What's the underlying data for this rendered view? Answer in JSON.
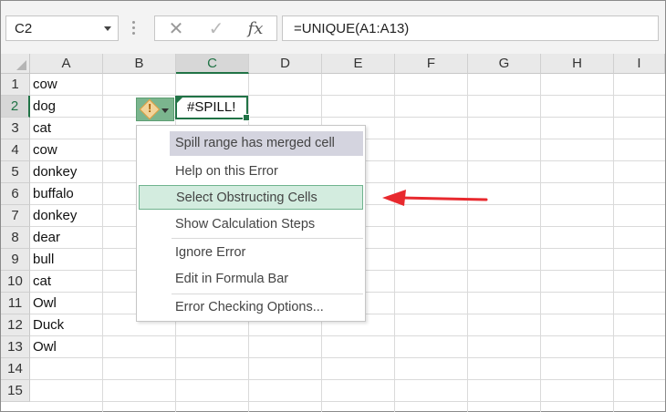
{
  "name_box": {
    "value": "C2"
  },
  "formula_bar": {
    "cancel_glyph": "✕",
    "enter_glyph": "✓",
    "fx_label": "fx",
    "formula": "=UNIQUE(A1:A13)"
  },
  "columns": [
    "A",
    "B",
    "C",
    "D",
    "E",
    "F",
    "G",
    "H",
    "I"
  ],
  "rows": [
    "1",
    "2",
    "3",
    "4",
    "5",
    "6",
    "7",
    "8",
    "9",
    "10",
    "11",
    "12",
    "13",
    "14",
    "15"
  ],
  "column_a": [
    "cow",
    "dog",
    "cat",
    "cow",
    "donkey",
    "buffalo",
    "donkey",
    "dear",
    "bull",
    "cat",
    "Owl",
    "Duck",
    "Owl"
  ],
  "active_cell": {
    "ref": "C2",
    "value": "#SPILL!"
  },
  "error_menu": {
    "title": "Spill range has merged cell",
    "items": [
      "Help on this Error",
      "Select Obstructing Cells",
      "Show Calculation Steps",
      "Ignore Error",
      "Edit in Formula Bar",
      "Error Checking Options..."
    ],
    "highlighted_index": 1
  },
  "colors": {
    "excel_green": "#217346",
    "arrow_red": "#e8292e",
    "menu_header_bg": "#d4d4df",
    "menu_hover_bg": "#d3ecdf"
  }
}
